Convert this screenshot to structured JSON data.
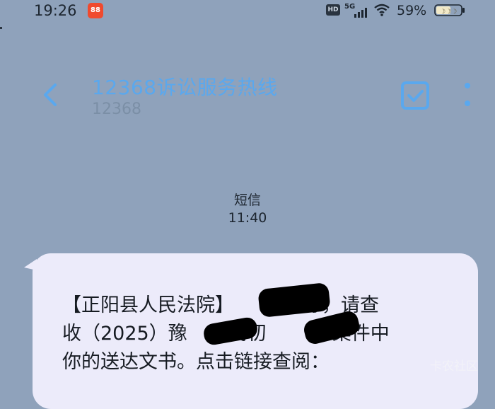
{
  "status_bar": {
    "time": "19:26",
    "app_badge_icon": "app-badge-icon",
    "hd": "HD",
    "network": "5G",
    "battery_percent": "59%",
    "battery_level": 0.59
  },
  "header": {
    "title": "12368诉讼服务热线",
    "subtitle": "12368"
  },
  "message_meta": {
    "type": "短信",
    "time": "11:40"
  },
  "message": {
    "line1": "【正阳县人民法院】",
    "greeting_suffix": "你好，请查",
    "line2_prefix": "收（2025）豫",
    "line2_mid": "民初",
    "line2_suffix": "号案件中",
    "line3": "你的送达文书。点击链接查阅："
  },
  "watermark": "卡农社区",
  "colors": {
    "background": "#8fa2bb",
    "accent": "#5aa8ee",
    "bubble": "#ecebfa"
  }
}
